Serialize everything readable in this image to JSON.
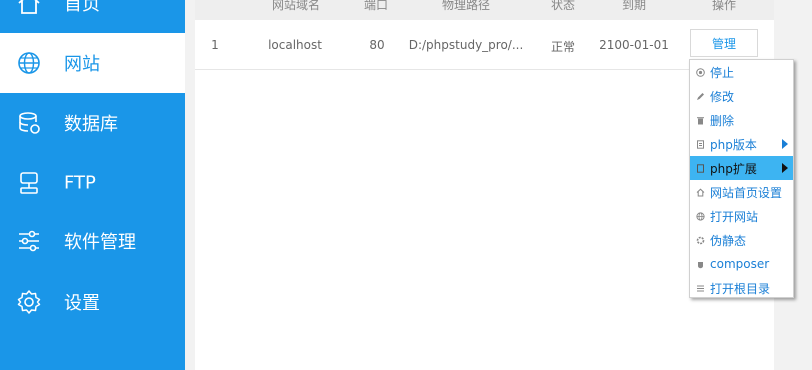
{
  "sidebar": {
    "items": [
      {
        "label": "首页",
        "icon": "home-icon"
      },
      {
        "label": "网站",
        "icon": "globe-icon",
        "active": true
      },
      {
        "label": "数据库",
        "icon": "database-icon"
      },
      {
        "label": "FTP",
        "icon": "ftp-icon"
      },
      {
        "label": "软件管理",
        "icon": "sliders-icon"
      },
      {
        "label": "设置",
        "icon": "gear-icon"
      }
    ]
  },
  "table": {
    "headers": [
      "网站域名",
      "端口",
      "物理路径",
      "状态",
      "到期",
      "操作"
    ],
    "rows": [
      {
        "index": "1",
        "domain": "localhost",
        "port": "80",
        "path": "D:/phpstudy_pro/...",
        "status": "正常",
        "expiry": "2100-01-01",
        "action": "管理"
      }
    ]
  },
  "context_menu": {
    "items": [
      {
        "label": "停止",
        "icon": "stop-icon"
      },
      {
        "label": "修改",
        "icon": "edit-icon"
      },
      {
        "label": "删除",
        "icon": "trash-icon"
      },
      {
        "label": "php版本",
        "icon": "php-version-icon",
        "submenu": true
      },
      {
        "label": "php扩展",
        "icon": "php-extension-icon",
        "submenu": true,
        "highlighted": true
      },
      {
        "label": "网站首页设置",
        "icon": "home-small-icon"
      },
      {
        "label": "打开网站",
        "icon": "globe-small-icon"
      },
      {
        "label": "伪静态",
        "icon": "rewrite-icon"
      },
      {
        "label": "composer",
        "icon": "composer-icon"
      },
      {
        "label": "打开根目录",
        "icon": "folder-list-icon"
      }
    ]
  },
  "colors": {
    "accent": "#1a96e8",
    "highlight": "#3db4f2"
  }
}
